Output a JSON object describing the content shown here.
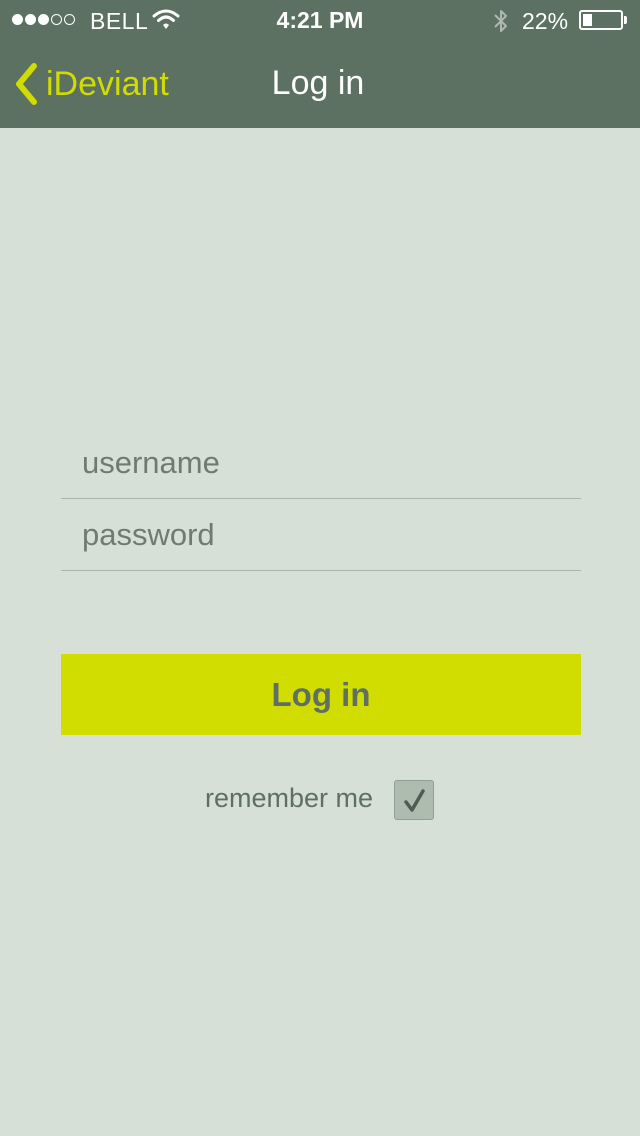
{
  "status_bar": {
    "carrier": "BELL",
    "signal_strength": 3,
    "signal_max": 5,
    "time": "4:21 PM",
    "battery_percent": "22%",
    "icons": [
      "wifi-icon",
      "bluetooth-icon",
      "battery-icon"
    ]
  },
  "nav": {
    "back_label": "iDeviant",
    "title": "Log in"
  },
  "form": {
    "username": {
      "value": "",
      "placeholder": "username"
    },
    "password": {
      "value": "",
      "placeholder": "password"
    },
    "login_label": "Log in",
    "remember_label": "remember me",
    "remember_checked": true
  },
  "colors": {
    "header_bg": "#5c7162",
    "page_bg": "#d7e0d7",
    "accent": "#d1dc00",
    "text": "#5f6f62"
  }
}
